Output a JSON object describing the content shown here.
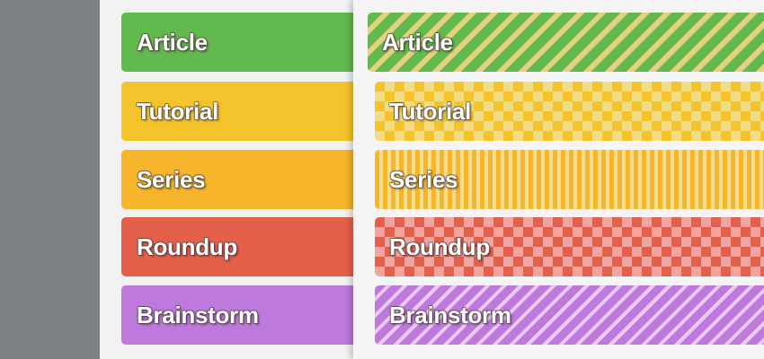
{
  "tags_solid": [
    {
      "label": "Article"
    },
    {
      "label": "Tutorial"
    },
    {
      "label": "Series"
    },
    {
      "label": "Roundup"
    },
    {
      "label": "Brainstorm"
    }
  ],
  "tags_patterned": [
    {
      "label": "Article"
    },
    {
      "label": "Tutorial"
    },
    {
      "label": "Series"
    },
    {
      "label": "Roundup"
    },
    {
      "label": "Brainstorm"
    }
  ],
  "colors": {
    "article": "#62b94d",
    "tutorial": "#f5c32c",
    "series": "#f6b52a",
    "roundup": "#e5604b",
    "brainstorm": "#bd79dc",
    "gutter": "#7d8285"
  },
  "patterns": {
    "article": "diagonal-stripes",
    "tutorial": "diamond-checker",
    "series": "vertical-stripes",
    "roundup": "diamond-checker",
    "brainstorm": "diagonal-stripes"
  }
}
